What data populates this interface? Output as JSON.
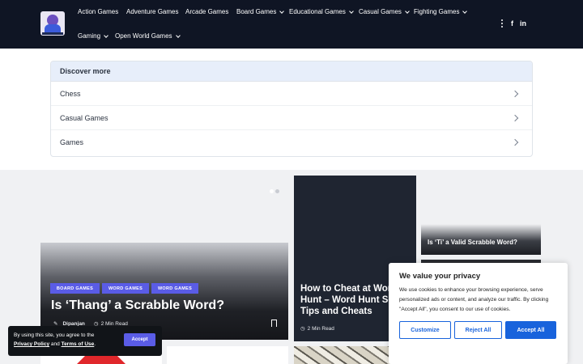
{
  "nav": {
    "items": [
      {
        "label": "Action Games",
        "dropdown": false
      },
      {
        "label": "Adventure Games",
        "dropdown": false
      },
      {
        "label": "Arcade Games",
        "dropdown": false
      },
      {
        "label": "Board Games",
        "dropdown": true
      },
      {
        "label": "Educational Games",
        "dropdown": true
      },
      {
        "label": "Casual Games",
        "dropdown": true
      },
      {
        "label": "Fighting Games",
        "dropdown": true
      },
      {
        "label": "Gaming",
        "dropdown": true
      },
      {
        "label": "Open World Games",
        "dropdown": true
      }
    ],
    "icons": [
      "more-vertical-icon",
      "facebook-icon",
      "linkedin-icon"
    ],
    "facebook_glyph": "f",
    "linkedin_glyph": "in"
  },
  "discover": {
    "title": "Discover more",
    "items": [
      "Chess",
      "Casual Games",
      "Games"
    ]
  },
  "featured": {
    "main": {
      "tags": [
        "BOARD GAMES",
        "WORD GAMES",
        "WORD GAMES"
      ],
      "title": "Is ‘Thang’ a Scrabble Word?",
      "author": "Dipanjan",
      "read_time": "2 Min Read"
    },
    "middle": {
      "title": "How to Cheat at Word Hunt – Word Hunt Solver Tips and Cheats",
      "read_time": "2 Min Read"
    },
    "right": {
      "title": "Is ‘Ti’ a Valid Scrabble Word?"
    }
  },
  "cookie_bar": {
    "text_prefix": "By using this site, you agree to the",
    "privacy_link": "Privacy Policy",
    "and": "and",
    "terms_link": "Terms of Use",
    "period": ".",
    "accept_label": "Accept"
  },
  "consent": {
    "title": "We value your privacy",
    "text": "We use cookies to enhance your browsing experience, serve personalized ads or content, and analyze our traffic. By clicking \"Accept All\", you consent to our use of cookies.",
    "customize_label": "Customize",
    "reject_label": "Reject All",
    "accept_label": "Accept All"
  },
  "colors": {
    "header_bg": "#0f1524",
    "tag_bg": "#5a5ce6",
    "consent_blue": "#1863dc",
    "discover_head_bg": "#e7eefa"
  }
}
